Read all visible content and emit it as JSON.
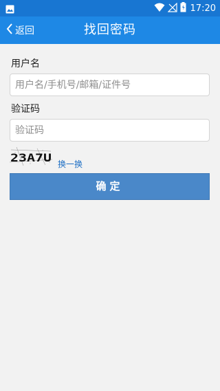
{
  "status_bar": {
    "time": "17:20",
    "icons": [
      "image-icon",
      "wifi-icon",
      "signal-icon",
      "battery-icon"
    ]
  },
  "app_bar": {
    "back_label": "返回",
    "title": "找回密码",
    "color": "#1e88e5"
  },
  "form": {
    "username": {
      "label": "用户名",
      "placeholder": "用户名/手机号/邮箱/证件号",
      "value": ""
    },
    "captcha": {
      "label": "验证码",
      "placeholder": "验证码",
      "value": "",
      "image_text": "23A7U",
      "refresh_label": "换一换"
    },
    "confirm_label": "确定",
    "confirm_color": "#4a88c9"
  }
}
